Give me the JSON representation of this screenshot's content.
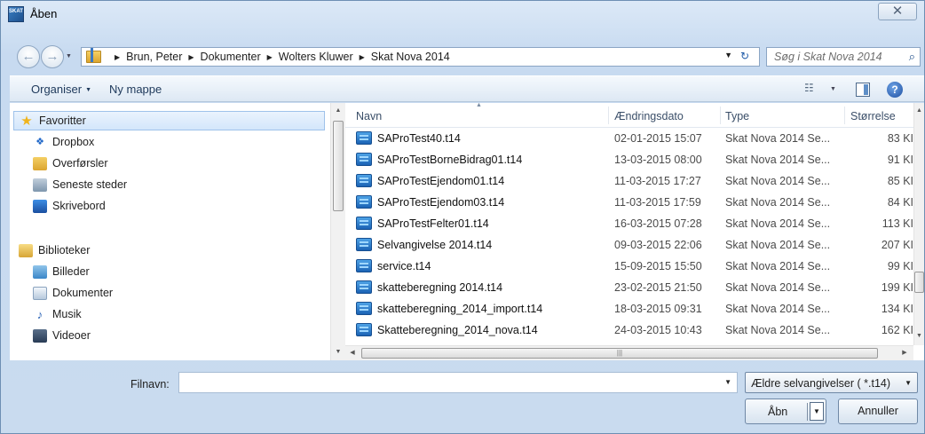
{
  "window": {
    "title": "Åben",
    "app_icon_text": "SKAT",
    "close": "✕"
  },
  "nav": {
    "back": "←",
    "forward": "→",
    "refresh": "↻"
  },
  "address": {
    "crumbs": [
      "Brun, Peter",
      "Dokumenter",
      "Wolters Kluwer",
      "Skat Nova 2014"
    ]
  },
  "search": {
    "placeholder": "Søg i Skat Nova 2014"
  },
  "toolbar": {
    "organize": "Organiser",
    "new_folder": "Ny mappe"
  },
  "sidebar": {
    "favorites": [
      {
        "label": "Favoritter",
        "icon": "star-icon"
      },
      {
        "label": "Dropbox",
        "icon": "dropbox-icon"
      },
      {
        "label": "Overførsler",
        "icon": "downloads-folder-icon"
      },
      {
        "label": "Seneste steder",
        "icon": "recent-places-icon"
      },
      {
        "label": "Skrivebord",
        "icon": "desktop-icon"
      }
    ],
    "libraries": [
      {
        "label": "Biblioteker",
        "icon": "libraries-icon"
      },
      {
        "label": "Billeder",
        "icon": "pictures-icon"
      },
      {
        "label": "Dokumenter",
        "icon": "documents-icon"
      },
      {
        "label": "Musik",
        "icon": "music-icon"
      },
      {
        "label": "Videoer",
        "icon": "videos-icon"
      }
    ]
  },
  "columns": {
    "name": "Navn",
    "date": "Ændringsdato",
    "type": "Type",
    "size": "Størrelse"
  },
  "files": [
    {
      "name": "SAProTest40.t14",
      "date": "02-01-2015 15:07",
      "type": "Skat Nova 2014 Se...",
      "size": "83 KI"
    },
    {
      "name": "SAProTestBorneBidrag01.t14",
      "date": "13-03-2015 08:00",
      "type": "Skat Nova 2014 Se...",
      "size": "91 KI"
    },
    {
      "name": "SAProTestEjendom01.t14",
      "date": "11-03-2015 17:27",
      "type": "Skat Nova 2014 Se...",
      "size": "85 KI"
    },
    {
      "name": "SAProTestEjendom03.t14",
      "date": "11-03-2015 17:59",
      "type": "Skat Nova 2014 Se...",
      "size": "84 KI"
    },
    {
      "name": "SAProTestFelter01.t14",
      "date": "16-03-2015 07:28",
      "type": "Skat Nova 2014 Se...",
      "size": "113 KI"
    },
    {
      "name": "Selvangivelse 2014.t14",
      "date": "09-03-2015 22:06",
      "type": "Skat Nova 2014 Se...",
      "size": "207 KI"
    },
    {
      "name": "service.t14",
      "date": "15-09-2015 15:50",
      "type": "Skat Nova 2014 Se...",
      "size": "99 KI"
    },
    {
      "name": "skatteberegning 2014.t14",
      "date": "23-02-2015 21:50",
      "type": "Skat Nova 2014 Se...",
      "size": "199 KI"
    },
    {
      "name": "skatteberegning_2014_import.t14",
      "date": "18-03-2015 09:31",
      "type": "Skat Nova 2014 Se...",
      "size": "134 KI"
    },
    {
      "name": "Skatteberegning_2014_nova.t14",
      "date": "24-03-2015 10:43",
      "type": "Skat Nova 2014 Se...",
      "size": "162 KI"
    }
  ],
  "bottom": {
    "filename_label": "Filnavn:",
    "filename_value": "",
    "filter": "Ældre selvangivelser ( *.t14)",
    "open": "Åbn",
    "cancel": "Annuller"
  },
  "colors": {
    "accent": "#1e5aa8",
    "selection": "#d3e6fb",
    "frame": "#c9dbef"
  }
}
